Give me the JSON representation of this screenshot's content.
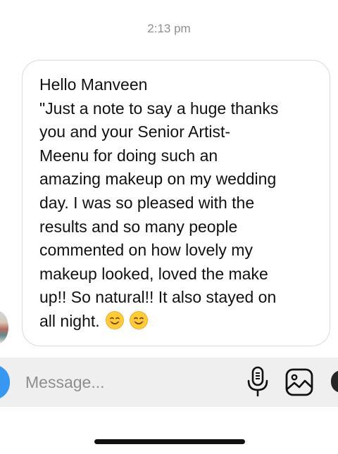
{
  "thread": {
    "timestamp": "2:13 pm",
    "message": {
      "lines": [
        "Hello Manveen",
        "\"Just a note to say a huge thanks",
        "you and your Senior Artist-",
        "Meenu for doing such an",
        "amazing makeup on my wedding",
        "day. I was so pleased with the",
        "results and so many people",
        "commented on how lovely my",
        "makeup looked, loved the make",
        "up!! So natural!! It also stayed on",
        "all night."
      ],
      "emoji": [
        "smiling-face-emoji",
        "smiling-face-emoji"
      ]
    }
  },
  "composer": {
    "placeholder": "Message...",
    "icons": [
      "camera-icon",
      "microphone-icon",
      "gallery-icon",
      "sticker-icon"
    ]
  },
  "colors": {
    "bubble_border": "#dbdbdb",
    "composer_bg": "#efefef",
    "accent": "#3897f0",
    "timestamp": "#8e8e93",
    "emoji_yellow": "#ffcc32"
  }
}
